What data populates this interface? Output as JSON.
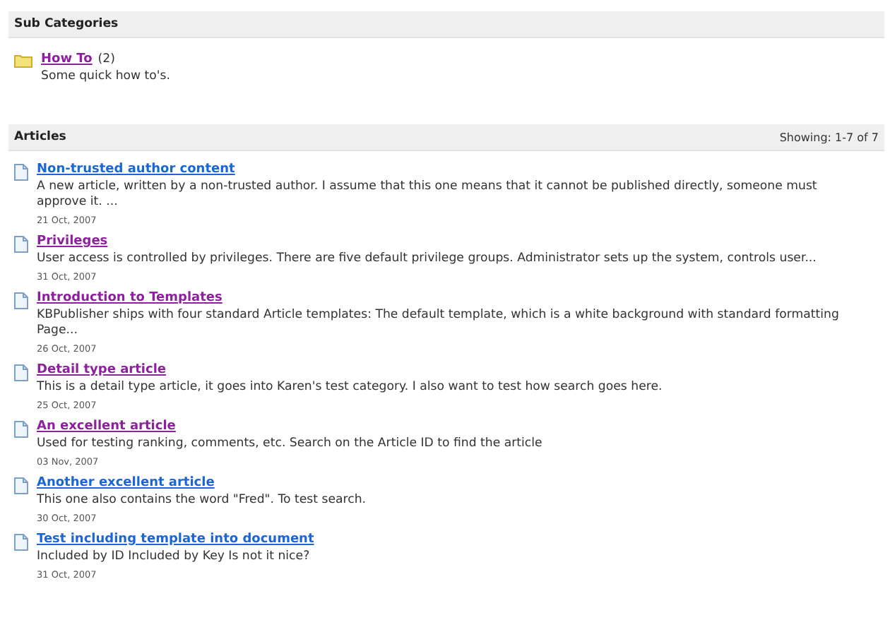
{
  "sub_categories": {
    "title": "Sub Categories",
    "items": [
      {
        "name": "How To",
        "visited": true,
        "count": "(2)",
        "description": "Some quick how to's."
      }
    ]
  },
  "articles": {
    "title": "Articles",
    "showing": "Showing: 1-7 of 7",
    "items": [
      {
        "title": "Non-trusted author content",
        "visited": false,
        "summary": "A new article, written by a non-trusted author.  I assume that this one means that it cannot be published directly, someone must approve it. ...",
        "date": "21 Oct, 2007"
      },
      {
        "title": "Privileges",
        "visited": true,
        "summary": "User access is controlled by privileges. There are five default privilege groups.  Administrator sets up the system, controls user...",
        "date": "31 Oct, 2007"
      },
      {
        "title": "Introduction to Templates",
        "visited": true,
        "summary": "KBPublisher ships with four standard Article templates: The default template, which is a white background with standard formatting Page...",
        "date": "26 Oct, 2007"
      },
      {
        "title": "Detail type article",
        "visited": true,
        "summary": "This is a detail type article, it goes into Karen's test category.  I also want to test how search goes here.",
        "date": "25 Oct, 2007"
      },
      {
        "title": "An excellent article",
        "visited": true,
        "summary": "Used for testing ranking, comments, etc. Search on the Article ID to find the article",
        "date": "03 Nov, 2007"
      },
      {
        "title": "Another excellent article",
        "visited": false,
        "summary": "This one also contains the word \"Fred\".  To test search.",
        "date": "30 Oct, 2007"
      },
      {
        "title": "Test including template into document",
        "visited": false,
        "summary": "Included by ID Included by Key Is not it nice?",
        "date": "31 Oct, 2007"
      }
    ]
  }
}
